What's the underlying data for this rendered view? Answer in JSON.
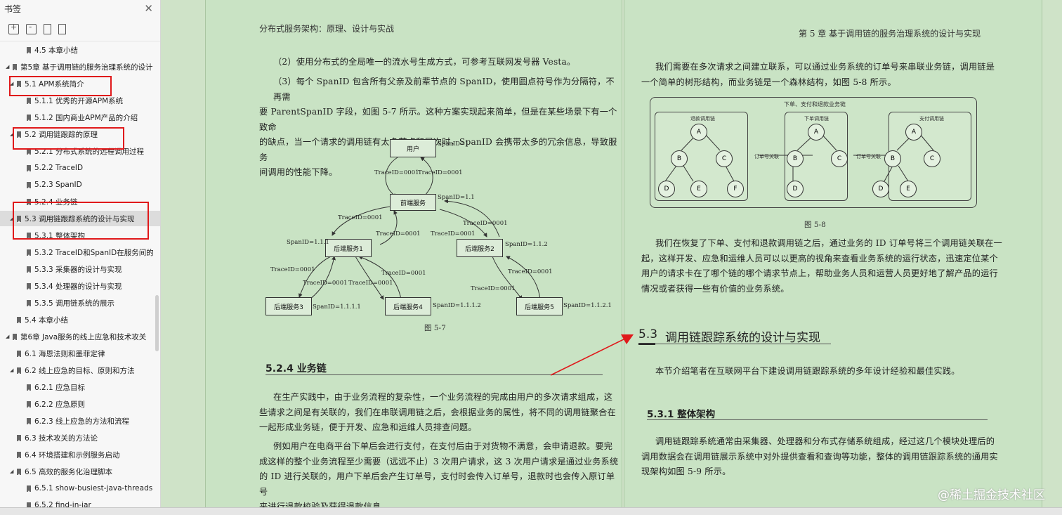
{
  "sidebar": {
    "title": "书签",
    "items": [
      {
        "label": "4.5 本章小结",
        "level": 2,
        "twisty": ""
      },
      {
        "label": "第5章 基于调用链的服务治理系统的设计",
        "level": 0,
        "twisty": "◢"
      },
      {
        "label": "5.1 APM系统简介",
        "level": 1,
        "twisty": "◢"
      },
      {
        "label": "5.1.1 优秀的开源APM系统",
        "level": 2,
        "twisty": ""
      },
      {
        "label": "5.1.2 国内商业APM产品的介绍",
        "level": 2,
        "twisty": ""
      },
      {
        "label": "5.2 调用链跟踪的原理",
        "level": 1,
        "twisty": "◢"
      },
      {
        "label": "5.2.1 分布式系统的远程调用过程",
        "level": 2,
        "twisty": ""
      },
      {
        "label": "5.2.2 TraceID",
        "level": 2,
        "twisty": ""
      },
      {
        "label": "5.2.3 SpanID",
        "level": 2,
        "twisty": ""
      },
      {
        "label": "5.2.4 业务链",
        "level": 2,
        "twisty": ""
      },
      {
        "label": "5.3 调用链跟踪系统的设计与实现",
        "level": 1,
        "twisty": "◢",
        "selected": true
      },
      {
        "label": "5.3.1 整体架构",
        "level": 2,
        "twisty": ""
      },
      {
        "label": "5.3.2 TraceID和SpanID在服务间的",
        "level": 2,
        "twisty": ""
      },
      {
        "label": "5.3.3 采集器的设计与实现",
        "level": 2,
        "twisty": ""
      },
      {
        "label": "5.3.4 处理器的设计与实现",
        "level": 2,
        "twisty": ""
      },
      {
        "label": "5.3.5 调用链系统的展示",
        "level": 2,
        "twisty": ""
      },
      {
        "label": "5.4 本章小结",
        "level": 1,
        "twisty": ""
      },
      {
        "label": "第6章 Java服务的线上应急和技术攻关",
        "level": 0,
        "twisty": "◢"
      },
      {
        "label": "6.1 海恩法则和墨菲定律",
        "level": 1,
        "twisty": ""
      },
      {
        "label": "6.2 线上应急的目标、原则和方法",
        "level": 1,
        "twisty": "◢"
      },
      {
        "label": "6.2.1 应急目标",
        "level": 2,
        "twisty": ""
      },
      {
        "label": "6.2.2 应急原则",
        "level": 2,
        "twisty": ""
      },
      {
        "label": "6.2.3 线上应急的方法和流程",
        "level": 2,
        "twisty": ""
      },
      {
        "label": "6.3 技术攻关的方法论",
        "level": 1,
        "twisty": ""
      },
      {
        "label": "6.4 环境搭建和示例服务启动",
        "level": 1,
        "twisty": ""
      },
      {
        "label": "6.5 高效的服务化治理脚本",
        "level": 1,
        "twisty": "◢"
      },
      {
        "label": "6.5.1 show-busiest-java-threads",
        "level": 2,
        "twisty": ""
      },
      {
        "label": "6.5.2 find-in-jar",
        "level": 2,
        "twisty": ""
      }
    ]
  },
  "left_page": {
    "header": "分布式服务架构：原理、设计与实战",
    "p1": "（2）使用分布式的全局唯一的流水号生成方式，可参考互联网发号器 Vesta。",
    "p2_lines": [
      "（3）每个 SpanID 包含所有父亲及前辈节点的 SpanID，使用圆点符号作为分隔符，不再需",
      "要 ParentSpanID 字段，如图 5-7 所示。这种方案实现起来简单，但是在某些场景下有一个致命",
      "的缺点，当一个请求的调用链有太多节点和层次时，SpanID 会携带太多的冗余信息，导致服务",
      "间调用的性能下降。"
    ],
    "diagram": {
      "nodes": [
        "用户",
        "前端服务",
        "后端服务1",
        "后端服务2",
        "后端服务3",
        "后端服务4",
        "后端服务5"
      ],
      "span_ids": [
        "SpanID=1",
        "SpanID=1.1",
        "SpanID=1.1.1",
        "SpanID=1.1.2",
        "SpanID=1.1.1.1",
        "SpanID=1.1.1.2",
        "SpanID=1.1.2.1"
      ],
      "trace_label": "TraceID=0001"
    },
    "fig_caption": "图 5-7",
    "section_title": "5.2.4   业务链",
    "p3_lines": [
      "在生产实践中，由于业务流程的复杂性，一个业务流程的完成由用户的多次请求组成，这",
      "些请求之间是有关联的，我们在串联调用链之后，会根据业务的属性，将不同的调用链聚合在",
      "一起形成业务链，便于开发、应急和运维人员排查问题。"
    ],
    "p4_lines": [
      "例如用户在电商平台下单后会进行支付，在支付后由于对货物不满意，会申请退款。要完",
      "成这样的整个业务流程至少需要（远远不止）3 次用户请求，这 3 次用户请求是通过业务系统",
      "的 ID 进行关联的，用户下单后会产生订单号，支付时会传入订单号，退款时也会传入原订单号",
      "来进行退款校验及获得退款信息。"
    ]
  },
  "right_page": {
    "header": "第 5 章   基于调用链的服务治理系统的设计与实现",
    "p1_lines": [
      "我们需要在多次请求之间建立联系，可以通过业务系统的订单号来串联业务链，调用链是",
      "一个简单的树形结构，而业务链是一个森林结构，如图 5-8 所示。"
    ],
    "figure": {
      "title": "下单、支付和退款业务链",
      "panels": [
        "退款调用链",
        "下单调用链",
        "支付调用链"
      ],
      "connector": "订单号关联"
    },
    "fig_caption": "图 5-8",
    "p2_lines": [
      "我们在恢复了下单、支付和退款调用链之后，通过业务的 ID 订单号将三个调用链关联在一",
      "起，这样开发、应急和运维人员可以以更高的视角来查看业务系统的运行状态，迅速定位某个",
      "用户的请求卡在了哪个链的哪个请求节点上，帮助业务人员和运营人员更好地了解产品的运行",
      "情况或者获得一些有价值的业务系统。"
    ],
    "section_num": "5.3",
    "section_title": "调用链跟踪系统的设计与实现",
    "p3": "本节介绍笔者在互联网平台下建设调用链跟踪系统的多年设计经验和最佳实践。",
    "sub_title": "5.3.1   整体架构",
    "p4_lines": [
      "调用链跟踪系统通常由采集器、处理器和分布式存储系统组成，经过这几个模块处理后的",
      "调用数据会在调用链展示系统中对外提供查看和查询等功能，整体的调用链跟踪系统的通用实",
      "现架构如图 5-9 所示。"
    ]
  },
  "watermark": "@稀土掘金技术社区",
  "colors": {
    "annotation_red": "#e0191b",
    "page_bg": "#c9e3c4"
  }
}
